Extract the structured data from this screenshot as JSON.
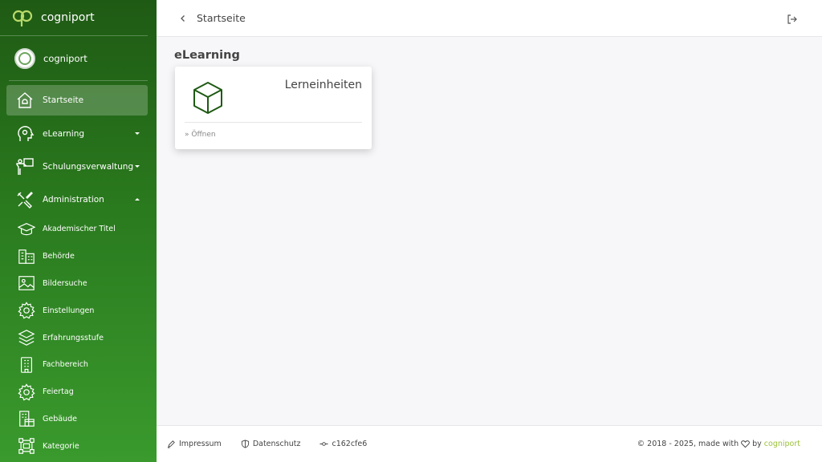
{
  "brand": {
    "name": "cogniport"
  },
  "user": {
    "name": "cogniport"
  },
  "nav": [
    {
      "label": "Startseite",
      "icon": "home-icon",
      "active": true
    },
    {
      "label": "eLearning",
      "icon": "head-icon",
      "caret": "down"
    },
    {
      "label": "Schulungsverwaltung",
      "icon": "presenter-icon",
      "caret": "down"
    },
    {
      "label": "Administration",
      "icon": "tools-icon",
      "caret": "up"
    }
  ],
  "subnav": [
    {
      "label": "Akademischer Titel",
      "icon": "graduation-cap-icon"
    },
    {
      "label": "Behörde",
      "icon": "buildings-icon"
    },
    {
      "label": "Bildersuche",
      "icon": "image-icon"
    },
    {
      "label": "Einstellungen",
      "icon": "gear-icon"
    },
    {
      "label": "Erfahrungsstufe",
      "icon": "layers-icon"
    },
    {
      "label": "Fachbereich",
      "icon": "building-icon"
    },
    {
      "label": "Feiertag",
      "icon": "gear-icon"
    },
    {
      "label": "Gebäude",
      "icon": "building-store-icon"
    },
    {
      "label": "Kategorie",
      "icon": "category-icon"
    }
  ],
  "topbar": {
    "title": "Startseite"
  },
  "main": {
    "section_title": "eLearning",
    "card": {
      "title": "Lerneinheiten",
      "link": "» Öffnen",
      "icon": "cube-icon"
    }
  },
  "footer": {
    "impressum": "Impressum",
    "datenschutz": "Datenschutz",
    "commit": "c162cfe6",
    "copyright": "© 2018 - 2025, made with",
    "by": "by",
    "brand": "cogniport"
  },
  "colors": {
    "sidebar_top": "#1f5a14",
    "sidebar_bottom": "#3a9a2d",
    "accent": "#9bc23c",
    "cube": "#1f5a14"
  }
}
